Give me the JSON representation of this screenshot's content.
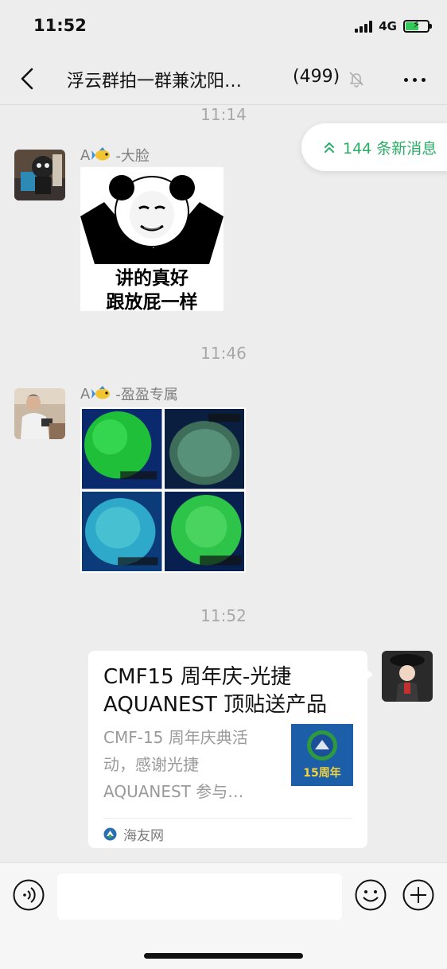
{
  "status_bar": {
    "time": "11:52",
    "network": "4G",
    "battery_color": "#34c759"
  },
  "nav": {
    "back_icon": "chevron-left-icon",
    "title": "浮云群拍一群兼沈阳…",
    "member_count": "(499)",
    "mute_icon": "bell-off-icon",
    "more_icon": "more-dots-icon"
  },
  "new_messages": {
    "icon": "double-chevron-up-icon",
    "label": "144 条新消息",
    "color": "#2aae67"
  },
  "messages": [
    {
      "timestamp": "11:14",
      "sender_name_prefix": "A",
      "sender_name_suffix": "-大脸",
      "type": "sticker",
      "sticker_lines": [
        "讲的真好",
        "跟放屁一样"
      ]
    },
    {
      "timestamp": "11:46",
      "sender_name_prefix": "A",
      "sender_name_suffix": "-盈盈专属",
      "type": "image-collage"
    },
    {
      "timestamp": "11:52",
      "type": "link-card",
      "outgoing": true,
      "card": {
        "title": "CMF15 周年庆-光捷 AQUANEST 顶贴送产品",
        "description": "CMF-15 周年庆典活动，感谢光捷 AQUANEST 参与…",
        "thumb_text": "15周年",
        "source": "海友网"
      }
    }
  ],
  "input_bar": {
    "voice_icon": "voice-icon",
    "input_value": "",
    "emoji_icon": "emoji-icon",
    "plus_icon": "plus-circle-icon"
  }
}
